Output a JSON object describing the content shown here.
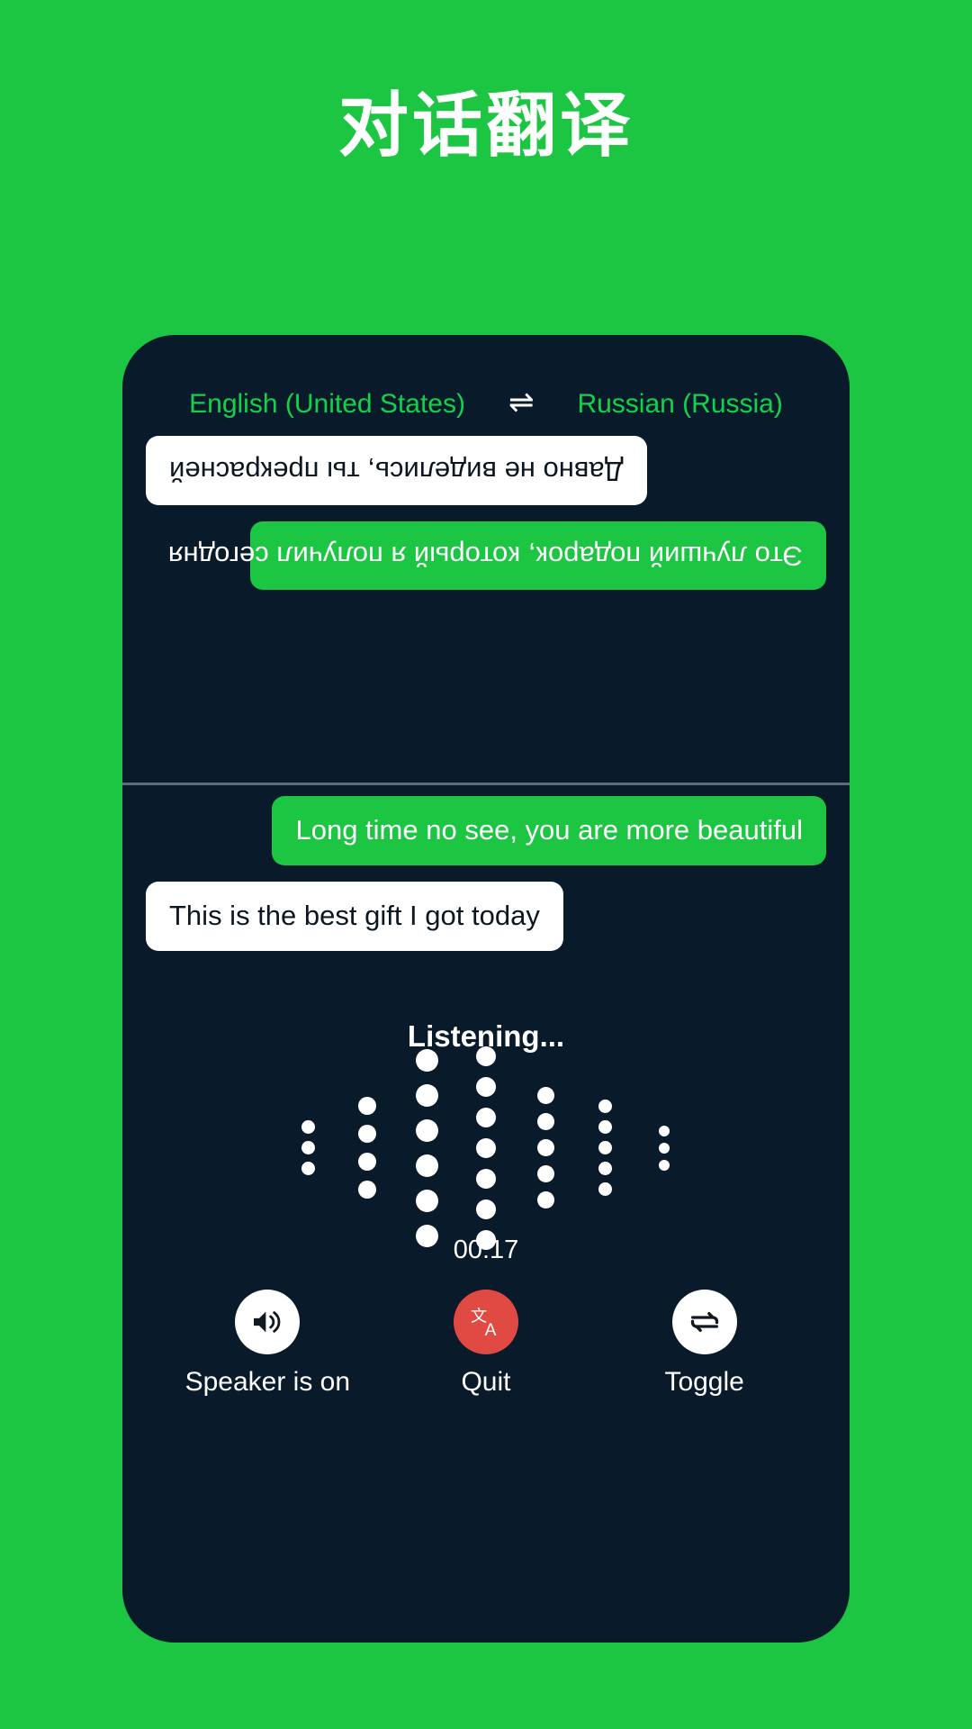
{
  "header": {
    "title": "对话翻译"
  },
  "colors": {
    "background": "#1cc643",
    "card": "#091a2b",
    "accent_green": "#13d14a",
    "bubble_green": "#1cc643",
    "bubble_white": "#ffffff",
    "quit_red": "#e04a43",
    "divider": "#5c6b7a",
    "text_white": "#ffffff"
  },
  "language_bar": {
    "source_language": "English (United States)",
    "swap_icon": "swap-horizontal-icon",
    "swap_glyph": "⇌",
    "target_language": "Russian (Russia)"
  },
  "conversation": {
    "top_panel_rotated": true,
    "top_messages": [
      {
        "text": "Это лучший подарок, который я получил сегодня",
        "style": "green",
        "align": "left"
      },
      {
        "text": "Давно не виделись, ты прекрасней",
        "style": "white",
        "align": "right"
      }
    ],
    "bottom_messages": [
      {
        "text": "Long time no see, you are more beautiful",
        "style": "green",
        "align": "right"
      },
      {
        "text": "This is the best gift I got today",
        "style": "white",
        "align": "left"
      }
    ]
  },
  "status": {
    "listening_label": "Listening...",
    "timer": "00:17"
  },
  "visualizer": {
    "type": "dot-waveform",
    "columns": [
      {
        "dots": 3,
        "size": 15
      },
      {
        "dots": 4,
        "size": 20
      },
      {
        "dots": 6,
        "size": 25
      },
      {
        "dots": 7,
        "size": 22
      },
      {
        "dots": 5,
        "size": 19
      },
      {
        "dots": 5,
        "size": 15
      },
      {
        "dots": 3,
        "size": 12
      }
    ]
  },
  "actions": [
    {
      "label": "Speaker is on",
      "icon": "speaker-on-icon",
      "circle_style": "white"
    },
    {
      "label": "Quit",
      "icon": "translate-icon",
      "circle_style": "red"
    },
    {
      "label": "Toggle",
      "icon": "toggle-swap-icon",
      "circle_style": "white"
    }
  ]
}
